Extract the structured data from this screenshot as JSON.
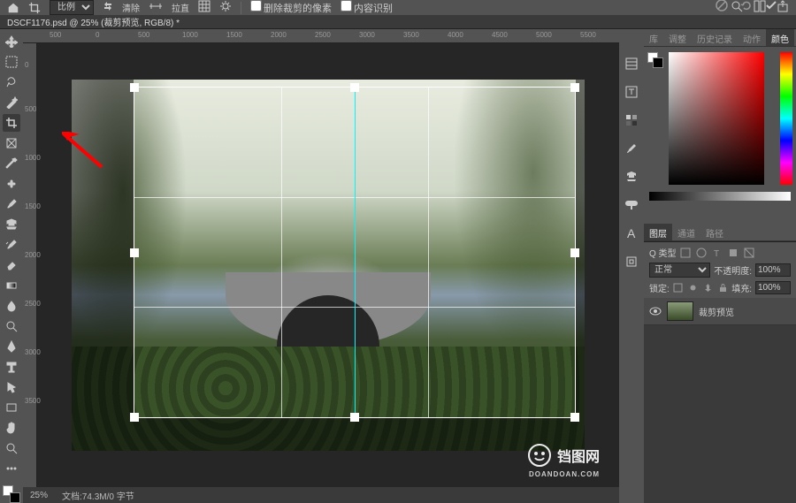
{
  "options": {
    "ratio_label": "比例",
    "clear": "清除",
    "straighten": "拉直",
    "delete_cropped": "删除裁剪的像素",
    "content_aware": "内容识别"
  },
  "document": {
    "tab_title": "DSCF1176.psd @ 25% (裁剪预览, RGB/8) *"
  },
  "ruler": {
    "h": [
      "500",
      "0",
      "500",
      "1000",
      "1500",
      "2000",
      "2500",
      "3000",
      "3500",
      "4000",
      "4500",
      "5000",
      "5500"
    ],
    "v": [
      "0",
      "500",
      "1000",
      "1500",
      "2000",
      "2500",
      "3000",
      "3500"
    ]
  },
  "status": {
    "zoom": "25%",
    "doc_info": "文档:74.3M/0 字节"
  },
  "panel_tabs_top": {
    "lib": "库",
    "adjust": "调整",
    "history": "历史记录",
    "actions": "动作",
    "color": "颜色"
  },
  "panel_tabs_bottom": {
    "layers": "图层",
    "channels": "通道",
    "paths": "路径"
  },
  "layers": {
    "kind_placeholder": "Q 类型",
    "blend_mode": "正常",
    "opacity_label": "不透明度:",
    "opacity_value": "100%",
    "lock_label": "锁定:",
    "fill_label": "填充:",
    "fill_value": "100%",
    "item_name": "裁剪预览"
  },
  "watermark": {
    "text": "铛图网",
    "sub": "DOANDOAN.COM"
  }
}
